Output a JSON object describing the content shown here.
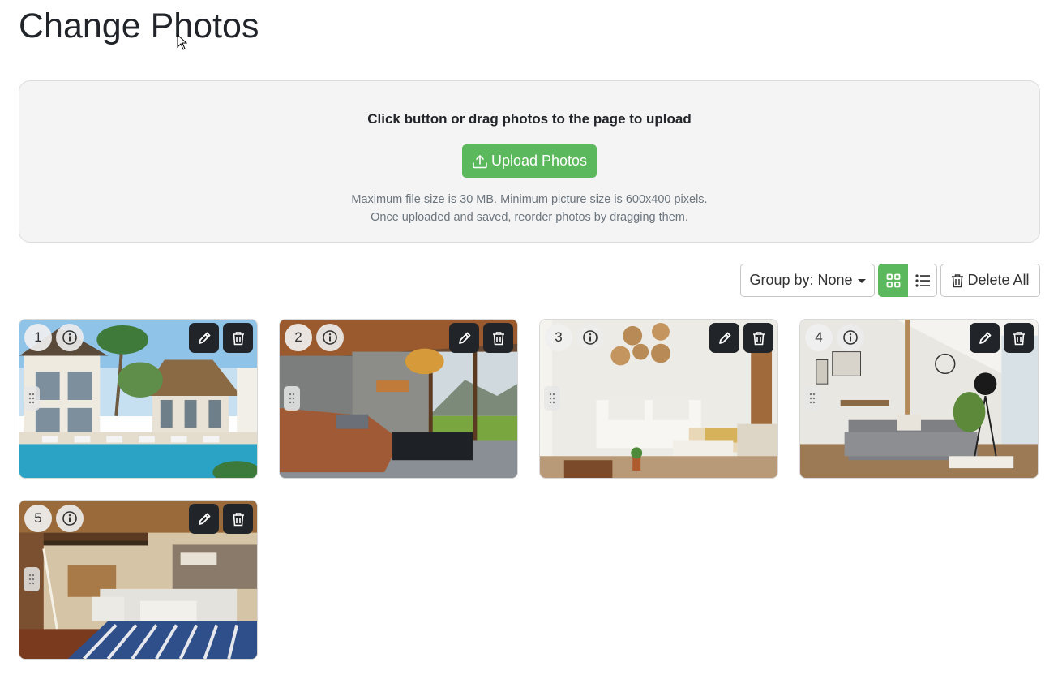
{
  "page": {
    "title": "Change Photos"
  },
  "upload": {
    "heading": "Click button or drag photos to the page to upload",
    "button_label": "Upload Photos",
    "note_line1": "Maximum file size is 30 MB. Minimum picture size is 600x400 pixels.",
    "note_line2": "Once uploaded and saved, reorder photos by dragging them."
  },
  "toolbar": {
    "group_by_label": "Group by: None",
    "active_view": "grid",
    "delete_all_label": "Delete All"
  },
  "photos": [
    {
      "number": "1",
      "scene": "tropical-villa-pool"
    },
    {
      "number": "2",
      "scene": "wood-living-room-lake-view"
    },
    {
      "number": "3",
      "scene": "white-bedroom"
    },
    {
      "number": "4",
      "scene": "grey-sofa-loft"
    },
    {
      "number": "5",
      "scene": "cabin-living-room"
    }
  ],
  "colors": {
    "accent": "#5cb85c",
    "dark_button": "#212529",
    "zone_bg": "#f4f4f4"
  }
}
